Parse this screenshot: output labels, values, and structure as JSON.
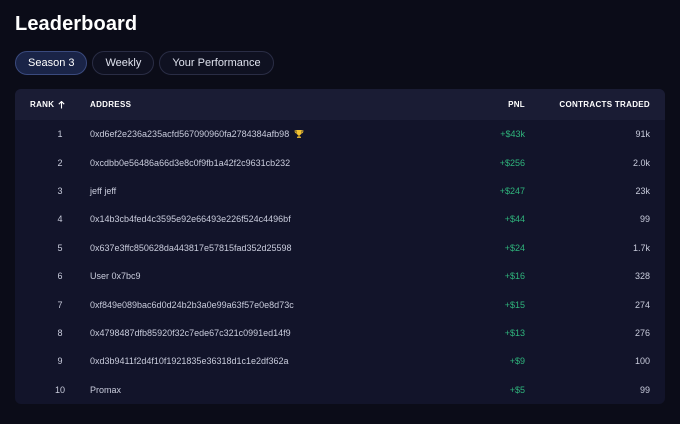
{
  "page": {
    "title": "Leaderboard"
  },
  "tabs": [
    {
      "label": "Season 3",
      "active": true
    },
    {
      "label": "Weekly",
      "active": false
    },
    {
      "label": "Your Performance",
      "active": false
    }
  ],
  "table": {
    "headers": {
      "rank": "RANK",
      "address": "ADDRESS",
      "pnl": "PNL",
      "contracts": "CONTRACTS TRADED"
    },
    "rows": [
      {
        "rank": "1",
        "address": "0xd6ef2e236a235acfd567090960fa2784384afb98",
        "pnl": "+$43k",
        "contracts": "91k",
        "trophy": true
      },
      {
        "rank": "2",
        "address": "0xcdbb0e56486a66d3e8c0f9fb1a42f2c9631cb232",
        "pnl": "+$256",
        "contracts": "2.0k"
      },
      {
        "rank": "3",
        "address": "jeff jeff",
        "pnl": "+$247",
        "contracts": "23k"
      },
      {
        "rank": "4",
        "address": "0x14b3cb4fed4c3595e92e66493e226f524c4496bf",
        "pnl": "+$44",
        "contracts": "99"
      },
      {
        "rank": "5",
        "address": "0x637e3ffc850628da443817e57815fad352d25598",
        "pnl": "+$24",
        "contracts": "1.7k"
      },
      {
        "rank": "6",
        "address": "User 0x7bc9",
        "pnl": "+$16",
        "contracts": "328"
      },
      {
        "rank": "7",
        "address": "0xf849e089bac6d0d24b2b3a0e99a63f57e0e8d73c",
        "pnl": "+$15",
        "contracts": "274"
      },
      {
        "rank": "8",
        "address": "0x4798487dfb85920f32c7ede67c321c0991ed14f9",
        "pnl": "+$13",
        "contracts": "276"
      },
      {
        "rank": "9",
        "address": "0xd3b9411f2d4f10f1921835e36318d1c1e2df362a",
        "pnl": "+$9",
        "contracts": "100"
      },
      {
        "rank": "10",
        "address": "Promax",
        "pnl": "+$5",
        "contracts": "99"
      }
    ]
  },
  "colors": {
    "accent_green": "#2fb47c",
    "trophy_gold": "#f2c230",
    "active_tab": "#1a2447"
  },
  "icons": {
    "sort": "arrow-up-icon",
    "winner": "trophy-icon"
  }
}
